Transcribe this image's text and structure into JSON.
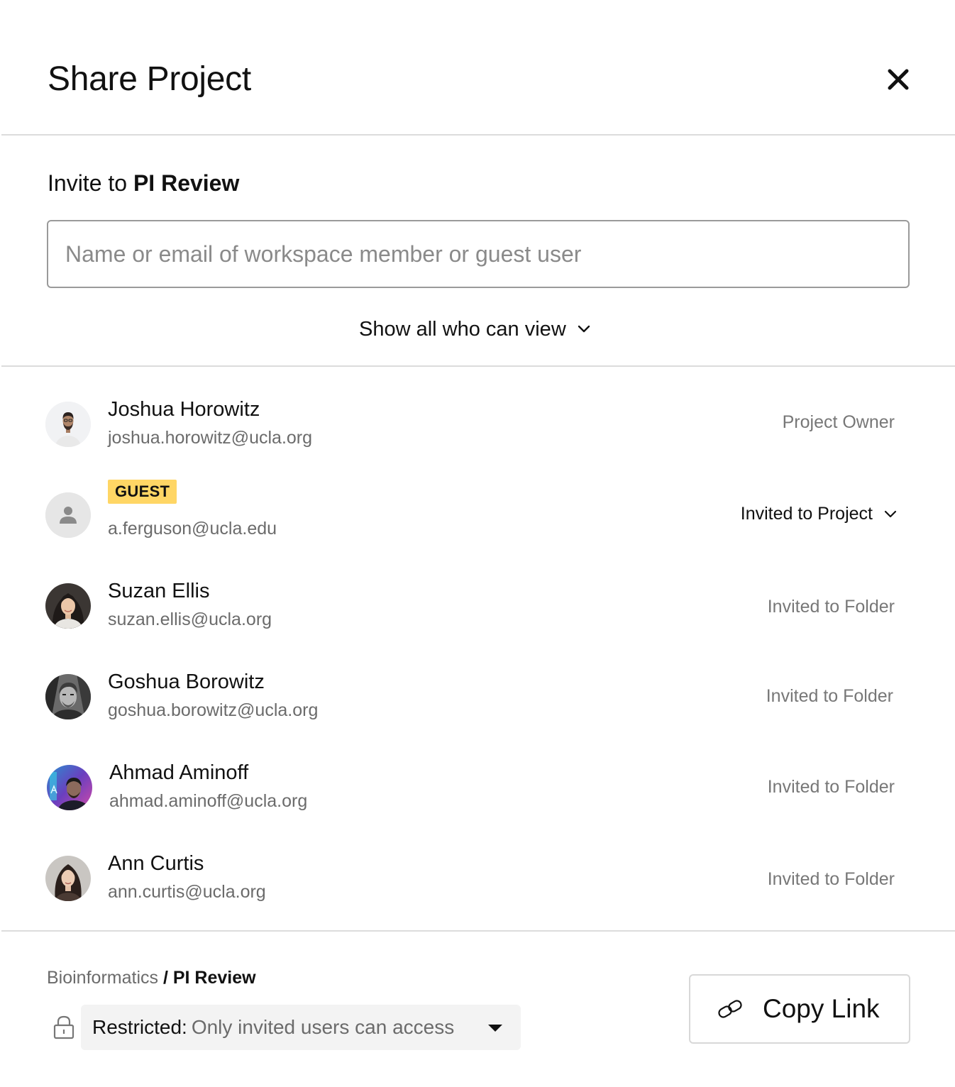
{
  "header": {
    "title": "Share Project",
    "close_icon": "close-icon"
  },
  "invite": {
    "prefix": "Invite to",
    "project_name": "PI Review",
    "placeholder": "Name or email of workspace member or guest user"
  },
  "show_all": {
    "label": "Show all who can view",
    "icon": "chevron-down-icon"
  },
  "members": [
    {
      "name": "Joshua Horowitz",
      "email": "joshua.horowitz@ucla.org",
      "role": "Project Owner"
    },
    {
      "badge": "GUEST",
      "email": "a.ferguson@ucla.edu",
      "role": "Invited to Project",
      "role_icon": "chevron-down-icon",
      "avatar_icon": "person-icon"
    },
    {
      "name": "Suzan Ellis",
      "email": "suzan.ellis@ucla.org",
      "role": "Invited to Folder"
    },
    {
      "name": "Goshua Borowitz",
      "email": "goshua.borowitz@ucla.org",
      "role": "Invited to Folder"
    },
    {
      "name": "Ahmad Aminoff",
      "email": "ahmad.aminoff@ucla.org",
      "role": "Invited to Folder"
    },
    {
      "name": "Ann Curtis",
      "email": "ann.curtis@ucla.org",
      "role": "Invited to Folder"
    }
  ],
  "footer": {
    "breadcrumb": {
      "parent": "Bioinformatics",
      "separator": "/",
      "current": "PI Review"
    },
    "access": {
      "label": "Restricted:",
      "description": "Only invited users can access",
      "lock_icon": "lock-icon",
      "caret_icon": "caret-down-icon"
    },
    "copy_link": {
      "label": "Copy Link",
      "icon": "link-icon"
    }
  },
  "colors": {
    "guest_badge": "#ffd665",
    "divider": "#dcdcdc",
    "muted_text": "#6b6b6b"
  }
}
